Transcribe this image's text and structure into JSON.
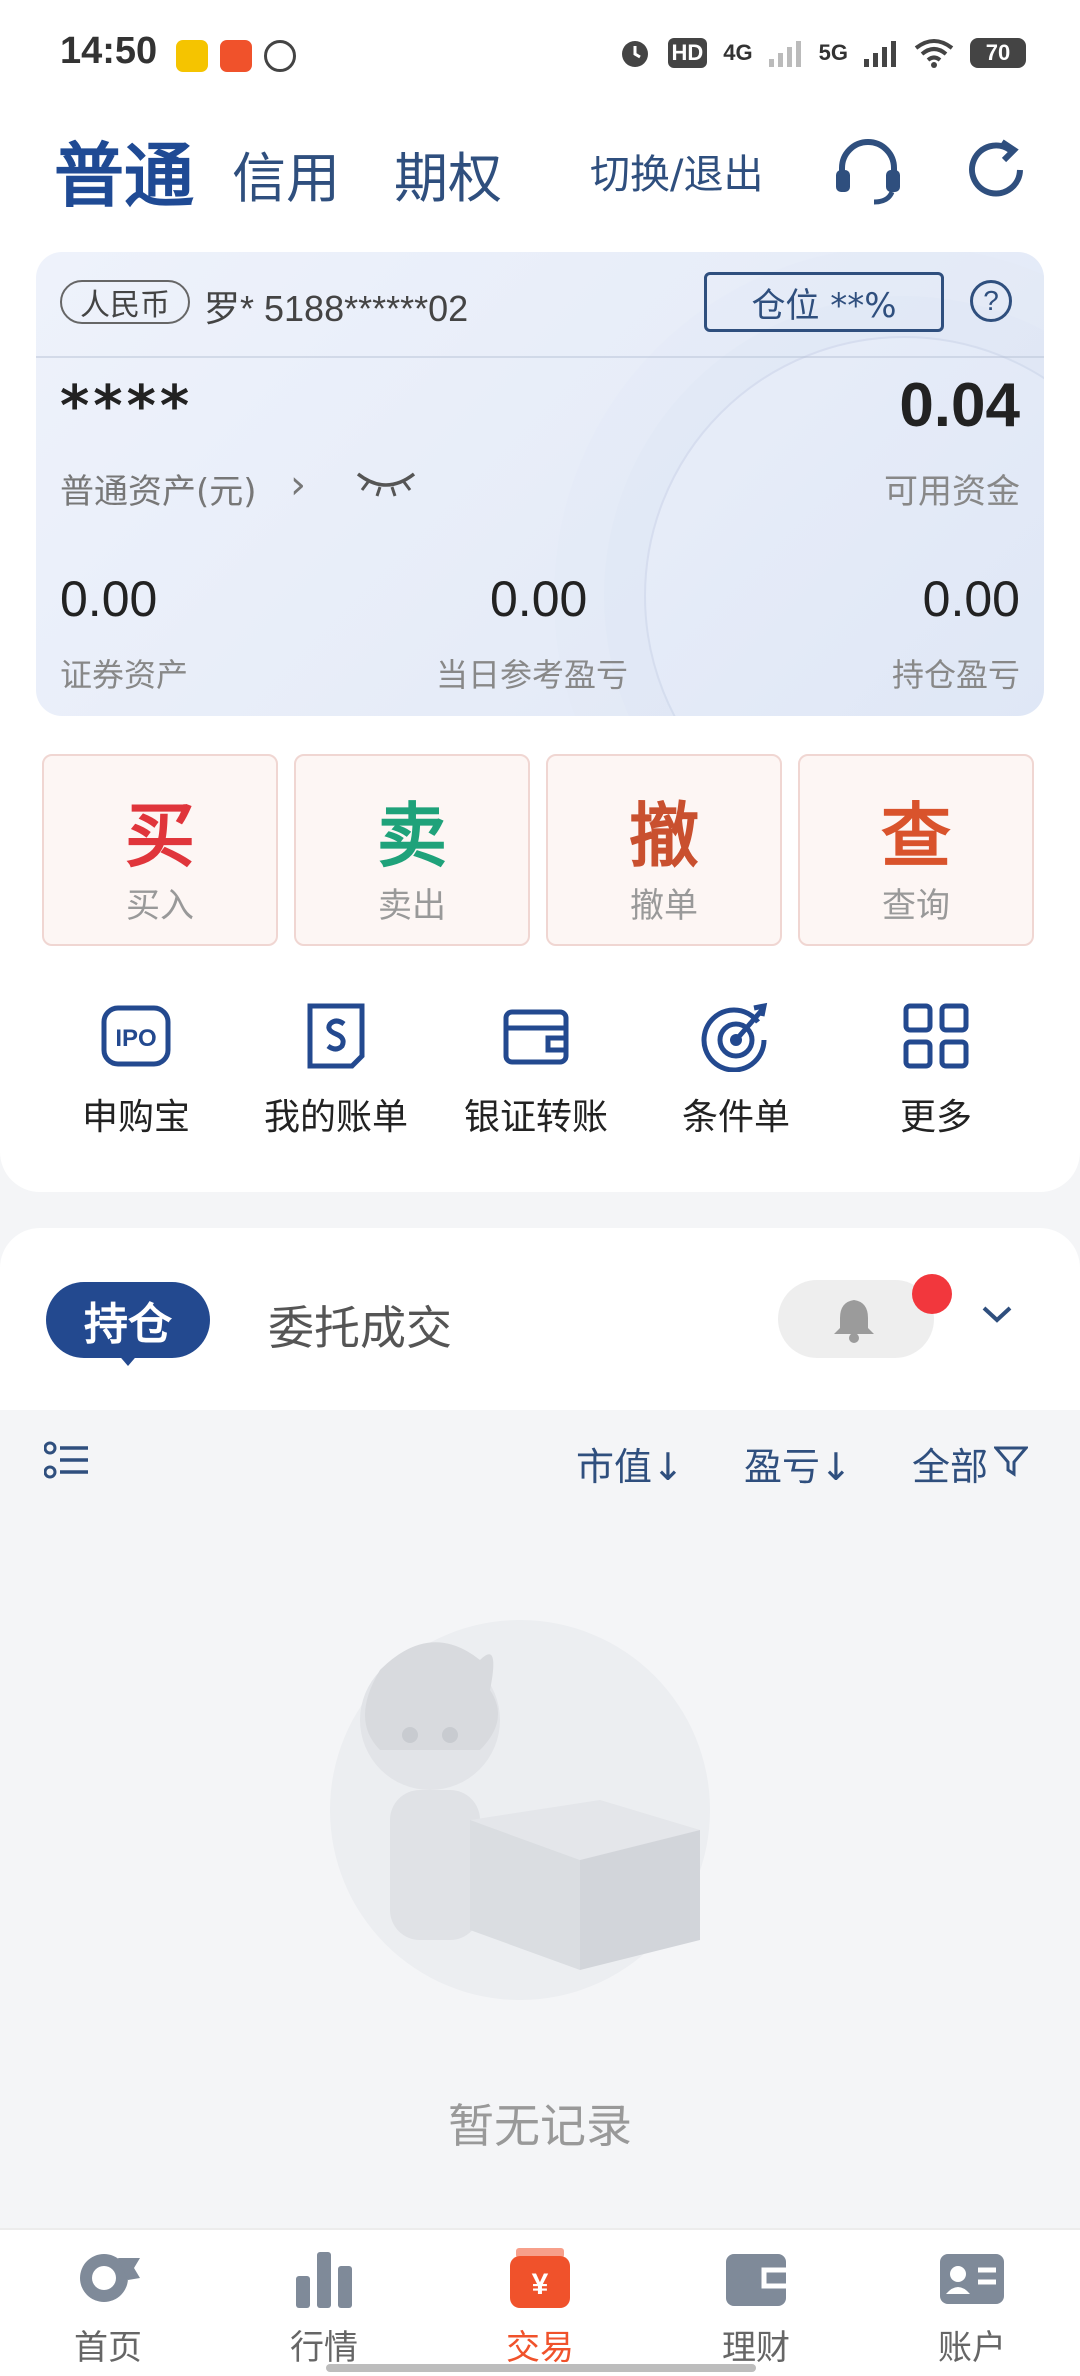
{
  "status_bar": {
    "time": "14:50",
    "hd_label": "HD",
    "network_4g": "4G",
    "network_5g": "5G",
    "battery": "70",
    "icons": [
      "alarm-icon",
      "wifi-icon",
      "signal-icon"
    ]
  },
  "top_nav": {
    "tabs": [
      "普通",
      "信用",
      "期权"
    ],
    "active_tab": "普通",
    "switch_exit_label": "切换/退出",
    "icons": [
      "headset-icon",
      "refresh-icon"
    ],
    "accent_color": "#1f4a94"
  },
  "account_card": {
    "currency": "人民币",
    "account": "罗* 5188******02",
    "position_label": "仓位 **%",
    "help_glyph": "?",
    "total_assets_value": "****",
    "total_assets_label": "普通资产(元)",
    "available_cash_value": "0.04",
    "available_cash_label": "可用资金",
    "stats": [
      {
        "value": "0.00",
        "label": "证券资产"
      },
      {
        "value": "0.00",
        "label": "当日参考盈亏"
      },
      {
        "value": "0.00",
        "label": "持仓盈亏"
      }
    ]
  },
  "trade_buttons": [
    {
      "glyph": "买",
      "label": "买入",
      "color": "#e0353b"
    },
    {
      "glyph": "卖",
      "label": "卖出",
      "color": "#1fa27a"
    },
    {
      "glyph": "撤",
      "label": "撤单",
      "color": "#c9502f"
    },
    {
      "glyph": "查",
      "label": "查询",
      "color": "#d9532c"
    }
  ],
  "quick_actions": [
    {
      "label": "申购宝",
      "icon": "ipo-icon",
      "icon_text": "IPO"
    },
    {
      "label": "我的账单",
      "icon": "bill-icon"
    },
    {
      "label": "银证转账",
      "icon": "wallet-icon"
    },
    {
      "label": "条件单",
      "icon": "target-icon"
    },
    {
      "label": "更多",
      "icon": "grid-icon"
    }
  ],
  "holdings": {
    "tabs": [
      "持仓",
      "委托成交"
    ],
    "active_tab": "持仓",
    "sort_options": [
      "市值↓",
      "盈亏↓",
      "全部"
    ],
    "empty_text": "暂无记录"
  },
  "bottom_nav": {
    "items": [
      {
        "label": "首页",
        "icon": "home-icon"
      },
      {
        "label": "行情",
        "icon": "chart-icon"
      },
      {
        "label": "交易",
        "icon": "trade-icon",
        "glyph": "¥"
      },
      {
        "label": "理财",
        "icon": "wallet-icon"
      },
      {
        "label": "账户",
        "icon": "account-icon"
      }
    ],
    "active": "交易",
    "active_color": "#f0522b"
  }
}
